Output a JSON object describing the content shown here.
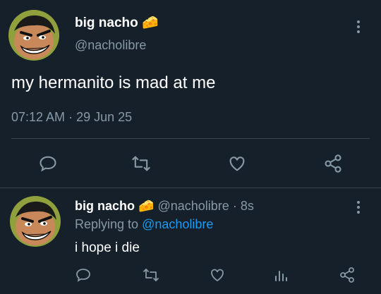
{
  "main_tweet": {
    "display_name": "big nacho",
    "name_emoji": "🧀",
    "handle": "@nacholibre",
    "text": "my hermanito is mad at me",
    "time": "07:12 AM",
    "separator": "·",
    "date": "29 Jun 25",
    "avatar_icon": "cartoon-face-avatar",
    "actions": [
      "reply-icon",
      "retweet-icon",
      "like-icon",
      "share-icon"
    ]
  },
  "reply_tweet": {
    "display_name": "big nacho",
    "name_emoji": "🧀",
    "handle": "@nacholibre",
    "separator": "·",
    "age": "8s",
    "replying_prefix": "Replying to",
    "replying_handle": "@nacholibre",
    "text": "i hope i die",
    "avatar_icon": "cartoon-face-avatar",
    "actions": [
      "reply-icon",
      "retweet-icon",
      "like-icon",
      "analytics-icon",
      "share-icon"
    ]
  },
  "colors": {
    "background": "#15202b",
    "text": "#ffffff",
    "muted": "#8899a6",
    "link": "#1d9bf0",
    "divider": "#38444d"
  }
}
